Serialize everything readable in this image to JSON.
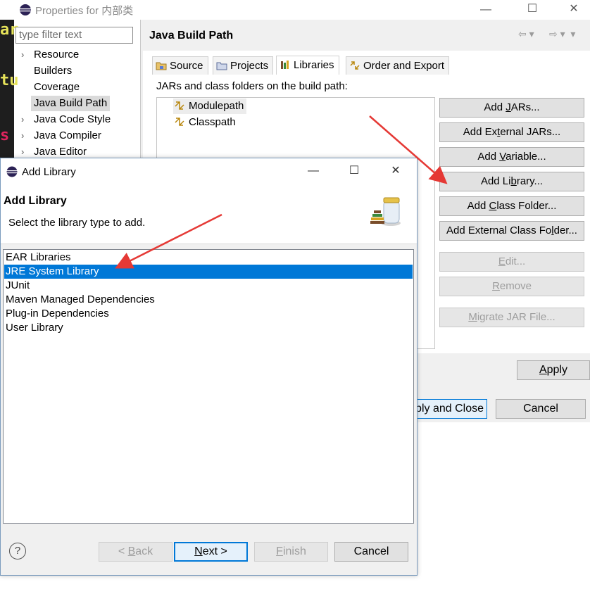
{
  "properties_window": {
    "title": "Properties for 内部类",
    "filter_placeholder": "type filter text",
    "nav_items": [
      "Resource",
      "Builders",
      "Coverage",
      "Java Build Path",
      "Java Code Style",
      "Java Compiler",
      "Java Editor"
    ],
    "page_title": "Java Build Path",
    "tabs": [
      "Source",
      "Projects",
      "Libraries",
      "Order and Export"
    ],
    "active_tab": "Libraries",
    "jars_caption": "JARs and class folders on the build path:",
    "tree": [
      "Modulepath",
      "Classpath"
    ],
    "buttons": {
      "add_jars": "Add JARs...",
      "add_external_jars": "Add External JARs...",
      "add_variable": "Add Variable...",
      "add_library": "Add Library...",
      "add_class_folder": "Add Class Folder...",
      "add_external_class_folder": "Add External Class Folder...",
      "edit": "Edit...",
      "remove": "Remove",
      "migrate_jar": "Migrate JAR File...",
      "apply": "Apply",
      "apply_and_close": "Apply and Close",
      "cancel": "Cancel"
    },
    "editor_strip_chars": [
      "ar",
      "tu",
      "s"
    ]
  },
  "add_library_dialog": {
    "title": "Add Library",
    "heading": "Add Library",
    "description": "Select the library type to add.",
    "libraries": [
      "EAR Libraries",
      "JRE System Library",
      "JUnit",
      "Maven Managed Dependencies",
      "Plug-in Dependencies",
      "User Library"
    ],
    "selected_library": "JRE System Library",
    "buttons": {
      "back": "< Back",
      "next": "Next >",
      "finish": "Finish",
      "cancel": "Cancel",
      "help": "?"
    }
  },
  "colors": {
    "selection": "#0078d7",
    "annotation_arrow": "#e53935"
  },
  "icons": [
    "eclipse-icon",
    "source-folder-icon",
    "projects-icon",
    "libraries-icon",
    "order-export-icon",
    "classpath-container-icon",
    "library-jars-icon",
    "help-icon"
  ]
}
